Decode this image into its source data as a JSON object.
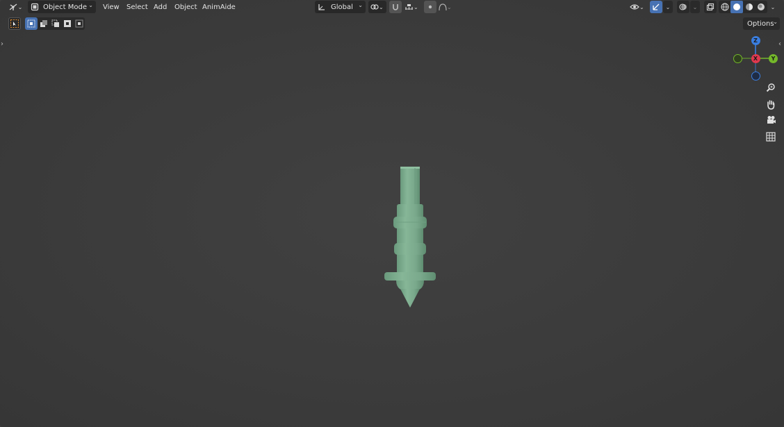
{
  "header": {
    "mode_label": "Object Mode",
    "menus": [
      "View",
      "Select",
      "Add",
      "Object",
      "AnimAide"
    ],
    "orientation_label": "Global",
    "options_label": "Options"
  },
  "gizmo": {
    "z_label": "Z",
    "y_label": "Y",
    "x_label": "X",
    "colors": {
      "z": "#3a7ee0",
      "y": "#74b82a",
      "x": "#e0384e"
    }
  },
  "tools": [
    "zoom-icon",
    "hand-icon",
    "camera-icon",
    "grid-icon"
  ],
  "object": {
    "color": "#7aa98c"
  }
}
